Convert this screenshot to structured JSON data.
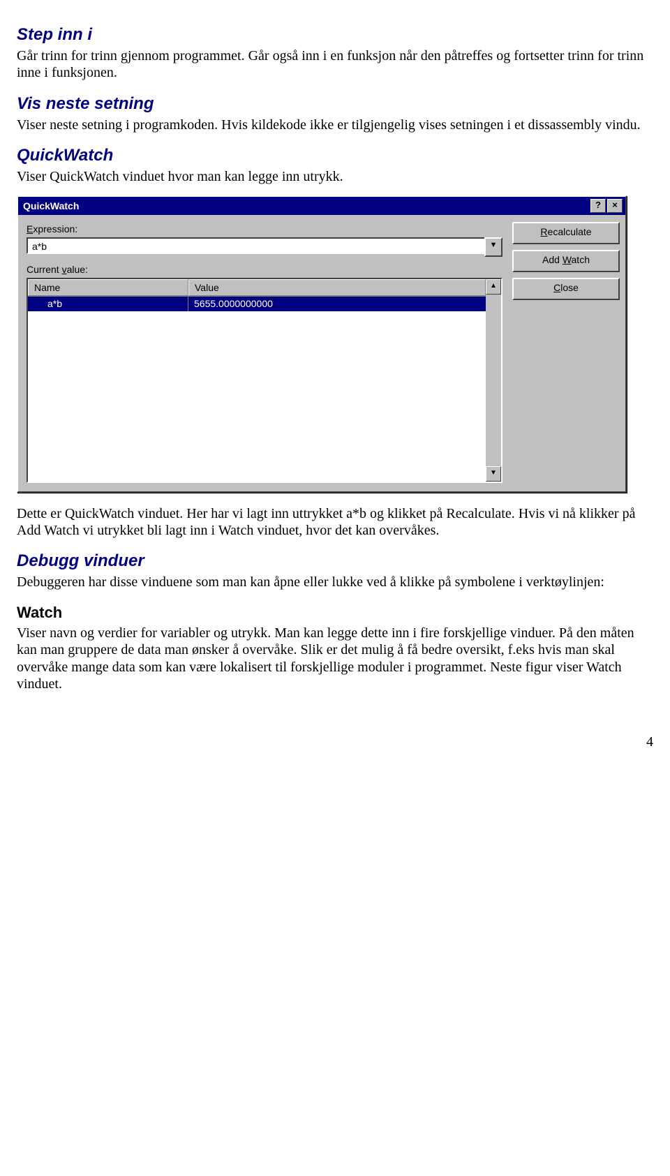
{
  "sections": {
    "step_inn": {
      "title": "Step inn i",
      "body": "Går trinn for trinn gjennom programmet. Går også inn i en funksjon når den påtreffes og fortsetter trinn for trinn inne i funksjonen."
    },
    "vis_neste": {
      "title": "Vis neste setning",
      "body": "Viser neste setning i programkoden. Hvis kildekode ikke er tilgjengelig vises setningen i et dissassembly vindu."
    },
    "quickwatch": {
      "title": "QuickWatch",
      "body": "Viser QuickWatch vinduet hvor man kan legge inn utrykk."
    },
    "after_qw": {
      "body": "Dette er QuickWatch vinduet. Her har vi lagt inn uttrykket a*b og klikket på Recalculate. Hvis vi nå klikker på Add Watch vi utrykket bli lagt inn i Watch vinduet, hvor det kan overvåkes."
    },
    "debugg": {
      "title": "Debugg vinduer",
      "body": "Debuggeren har disse vinduene som man kan åpne eller lukke ved å klikke på symbolene i verktøylinjen:"
    },
    "watch": {
      "title": "Watch",
      "body": "Viser navn og verdier for variabler og utrykk. Man kan legge dette inn i fire forskjellige vinduer. På den måten kan man gruppere de data man ønsker å overvåke. Slik er det mulig å få bedre oversikt, f.eks hvis man skal overvåke mange data som kan være lokalisert til forskjellige moduler i programmet. Neste figur viser Watch vinduet."
    }
  },
  "qw": {
    "title": "QuickWatch",
    "labels": {
      "expression_pre": "E",
      "expression_post": "xpression:",
      "current_pre": "Current ",
      "current_u": "v",
      "current_post": "alue:"
    },
    "expression_value": "a*b",
    "columns": {
      "name": "Name",
      "value": "Value"
    },
    "row": {
      "name": "a*b",
      "value": "5655.0000000000"
    },
    "buttons": {
      "recalc_u": "R",
      "recalc_post": "ecalculate",
      "addwatch_pre": "Add ",
      "addwatch_u": "W",
      "addwatch_post": "atch",
      "close_u": "C",
      "close_post": "lose"
    },
    "icons": {
      "help": "?",
      "close": "×",
      "down": "▼",
      "up": "▲"
    }
  },
  "page_number": "4"
}
